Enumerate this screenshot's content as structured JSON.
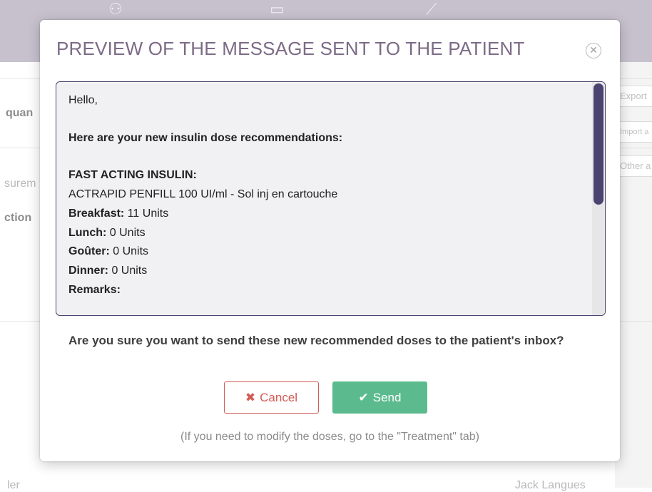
{
  "background": {
    "nav_icons": [
      "users-icon",
      "chat-icon",
      "chart-icon"
    ],
    "fragments": {
      "quantity": "quan",
      "export": "Export",
      "import": "Import a",
      "other": "Other a",
      "measurements": "surem",
      "section": "ction",
      "bottom_left": "ler",
      "bottom_right": "Jack Langues"
    }
  },
  "modal": {
    "title": "PREVIEW OF THE MESSAGE SENT TO THE PATIENT",
    "close_icon": "close-circle-icon",
    "message": {
      "greeting": "Hello,",
      "heading": "Here are your new insulin dose recommendations:",
      "section_title": "FAST ACTING INSULIN:",
      "product": "ACTRAPID PENFILL 100 UI/ml - Sol inj en cartouche",
      "doses": [
        {
          "label": "Breakfast:",
          "value": " 11 Units"
        },
        {
          "label": "Lunch:",
          "value": " 0 Units"
        },
        {
          "label": "Goûter:",
          "value": " 0 Units"
        },
        {
          "label": "Dinner:",
          "value": " 0 Units"
        }
      ],
      "remarks_label": "Remarks:"
    },
    "confirm_question": "Are you sure you want to send these new recommended doses to the patient's inbox?",
    "cancel": {
      "icon": "✖",
      "label": "Cancel",
      "color": "#d35a55"
    },
    "send": {
      "icon": "✔",
      "label": "Send",
      "color": "#5cbb8e"
    },
    "hint": "(If you need to modify the doses, go to the \"Treatment\" tab)"
  },
  "colors": {
    "title": "#7c6b86",
    "accent": "#4b4470",
    "topbar": "#c7c1ce"
  }
}
